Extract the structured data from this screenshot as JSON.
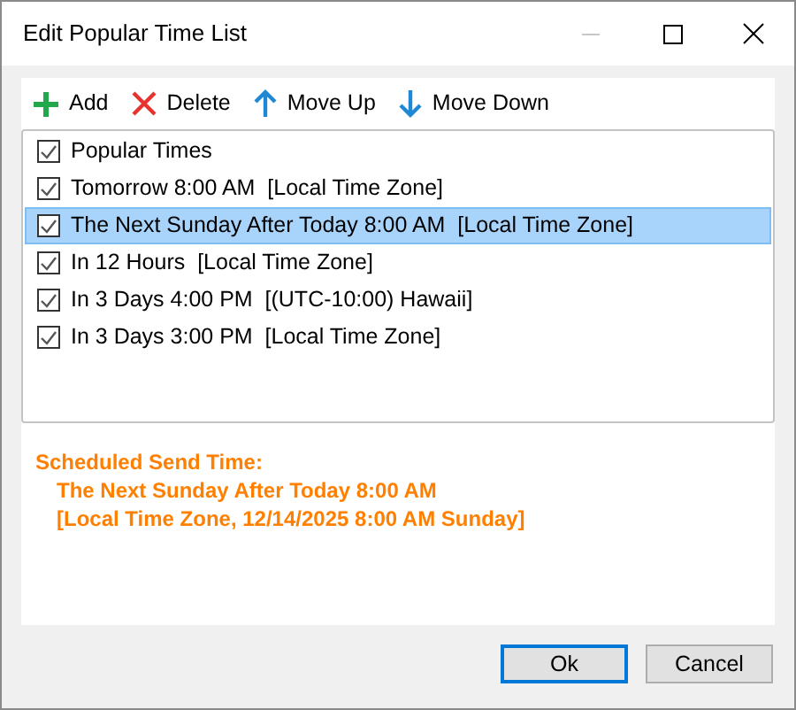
{
  "window": {
    "title": "Edit Popular Time List"
  },
  "toolbar": [
    {
      "kind": "add",
      "label": "Add"
    },
    {
      "kind": "delete",
      "label": "Delete"
    },
    {
      "kind": "up",
      "label": "Move Up"
    },
    {
      "kind": "down",
      "label": "Move Down"
    }
  ],
  "list": [
    {
      "label": "Popular Times",
      "checked": true,
      "selected": false
    },
    {
      "label": "Tomorrow 8:00 AM  [Local Time Zone]",
      "checked": true,
      "selected": false
    },
    {
      "label": "The Next Sunday After Today 8:00 AM  [Local Time Zone]",
      "checked": true,
      "selected": true
    },
    {
      "label": "In 12 Hours  [Local Time Zone]",
      "checked": true,
      "selected": false
    },
    {
      "label": "In 3 Days 4:00 PM  [(UTC-10:00) Hawaii]",
      "checked": true,
      "selected": false
    },
    {
      "label": "In 3 Days 3:00 PM  [Local Time Zone]",
      "checked": true,
      "selected": false
    }
  ],
  "summary": {
    "heading": "Scheduled Send Time:",
    "lines": [
      "The Next Sunday After Today 8:00 AM",
      "[Local Time Zone, 12/14/2025 8:00 AM Sunday]"
    ]
  },
  "buttons": [
    {
      "label": "Ok",
      "default": true
    },
    {
      "label": "Cancel",
      "default": false
    }
  ]
}
